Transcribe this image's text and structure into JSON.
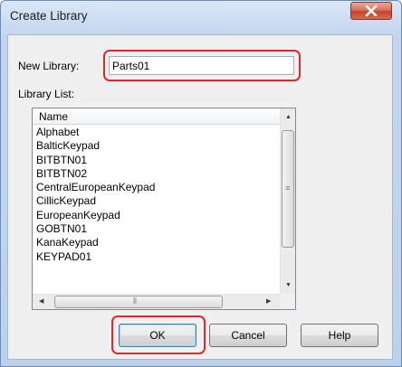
{
  "window": {
    "title": "Create Library"
  },
  "new_library": {
    "label": "New Library:",
    "value": "Parts01"
  },
  "library_list": {
    "label": "Library List:",
    "column_header": "Name",
    "items": [
      "Alphabet",
      "BalticKeypad",
      "BITBTN01",
      "BITBTN02",
      "CentralEuropeanKeypad",
      "CillicKeypad",
      "EuropeanKeypad",
      "GOBTN01",
      "KanaKeypad",
      "KEYPAD01"
    ]
  },
  "buttons": {
    "ok": "OK",
    "cancel": "Cancel",
    "help": "Help"
  },
  "colors": {
    "highlight": "#e5252e",
    "close_button": "#c3452e",
    "window_frame": "#c2d6ef"
  },
  "icons": {
    "close": "close-icon",
    "scroll_up": "scroll-up-arrow-icon",
    "scroll_down": "scroll-down-arrow-icon",
    "scroll_left": "scroll-left-arrow-icon",
    "scroll_right": "scroll-right-arrow-icon"
  }
}
